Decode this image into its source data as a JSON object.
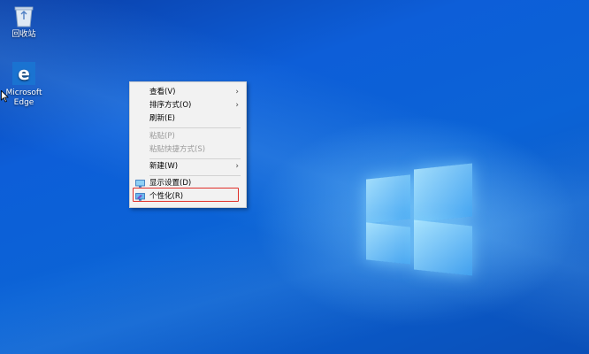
{
  "desktop": {
    "icons": [
      {
        "label": "回收站",
        "icon": "recycle-bin-icon"
      },
      {
        "label_line1": "Microsoft",
        "label_line2": "Edge",
        "icon": "edge-icon"
      }
    ]
  },
  "context_menu": {
    "items": [
      {
        "label": "查看(V)",
        "submenu": true,
        "enabled": true
      },
      {
        "label": "排序方式(O)",
        "submenu": true,
        "enabled": true
      },
      {
        "label": "刷新(E)",
        "submenu": false,
        "enabled": true
      },
      {
        "label": "粘贴(P)",
        "submenu": false,
        "enabled": false
      },
      {
        "label": "粘贴快捷方式(S)",
        "submenu": false,
        "enabled": false
      },
      {
        "label": "新建(W)",
        "submenu": true,
        "enabled": true
      },
      {
        "label": "显示设置(D)",
        "submenu": false,
        "enabled": true,
        "icon": "display-settings-icon"
      },
      {
        "label": "个性化(R)",
        "submenu": false,
        "enabled": true,
        "icon": "personalize-icon",
        "highlighted": true
      }
    ]
  },
  "colors": {
    "wallpaper": "#0b5fd6",
    "highlight_border": "#e0302a",
    "menu_bg": "#f2f2f2"
  }
}
